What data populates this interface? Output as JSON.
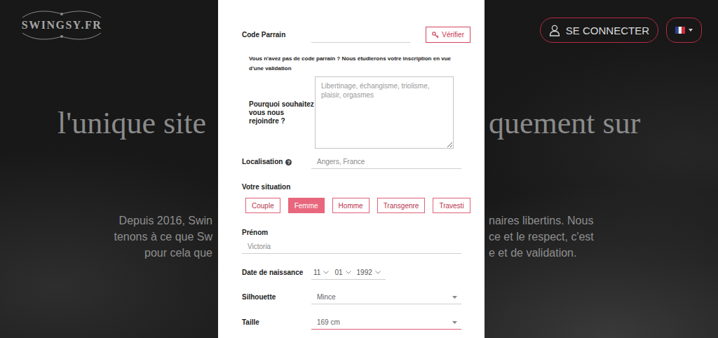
{
  "logo": "SWINGSY.FR",
  "header": {
    "login_button": "SE CONNECTER"
  },
  "hero": {
    "title_left": "l'unique site",
    "title_right": "quement sur",
    "paragraph_left": [
      "Depuis 2016, Swin",
      "tenons à ce que Sw",
      "pour cela que"
    ],
    "paragraph_right": [
      "naires libertins. Nous",
      "ce et le respect, c'est",
      "e et de validation."
    ]
  },
  "modal": {
    "referral": {
      "label": "Code Parrain",
      "value": "",
      "button": "Vérifier"
    },
    "note": "Vous n'avez pas de code parrain ? Nous étudierons votre inscription en vue d'une validation",
    "motivation": {
      "label": "Pourquoi souhaitez vous nous rejoindre ?",
      "placeholder": "Libertinage, échangisme, triolisme, plaisir, orgasmes"
    },
    "location": {
      "label": "Localisation",
      "help": "?",
      "placeholder": "Angers, France"
    },
    "situation": {
      "label": "Votre situation",
      "options": [
        {
          "label": "Couple",
          "selected": false
        },
        {
          "label": "Femme",
          "selected": true
        },
        {
          "label": "Homme",
          "selected": false
        },
        {
          "label": "Transgenre",
          "selected": false
        },
        {
          "label": "Travesti",
          "selected": false
        }
      ]
    },
    "first_name": {
      "label": "Prénom",
      "placeholder": "Victoria"
    },
    "birth_date": {
      "label": "Date de naissance",
      "parts": [
        "11",
        "01",
        "1992"
      ]
    },
    "silhouette": {
      "label": "Silhouette",
      "value": "Mince",
      "focused": false
    },
    "height": {
      "label": "Taille",
      "value": "169 cm",
      "focused": true
    }
  }
}
